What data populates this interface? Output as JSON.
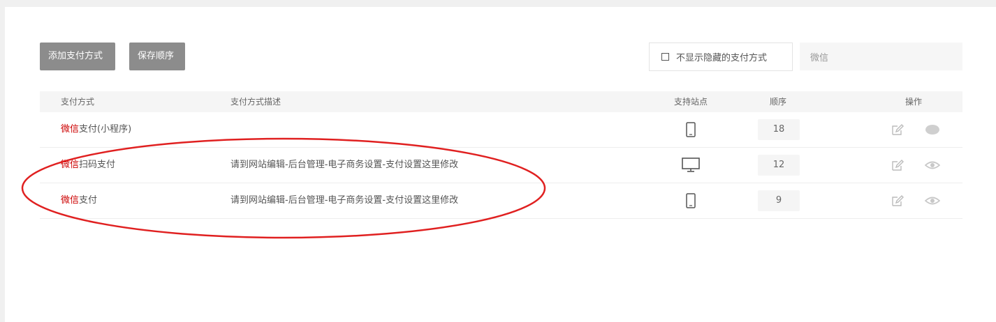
{
  "toolbar": {
    "add_label": "添加支付方式",
    "save_label": "保存顺序",
    "hide_hidden_label": "不显示隐藏的支付方式",
    "search_value": "微信"
  },
  "table": {
    "headers": {
      "method": "支付方式",
      "description": "支付方式描述",
      "site": "支持站点",
      "order": "顺序",
      "actions": "操作"
    },
    "rows": [
      {
        "name_highlight": "微信",
        "name_rest": "支付(小程序)",
        "description": "",
        "site_icon": "mobile-icon",
        "order": "18",
        "visible": false
      },
      {
        "name_highlight": "微信",
        "name_rest": "扫码支付",
        "description": "请到网站编辑-后台管理-电子商务设置-支付设置这里修改",
        "site_icon": "desktop-icon",
        "order": "12",
        "visible": true
      },
      {
        "name_highlight": "微信",
        "name_rest": "支付",
        "description": "请到网站编辑-后台管理-电子商务设置-支付设置这里修改",
        "site_icon": "mobile-icon",
        "order": "9",
        "visible": true
      }
    ]
  },
  "colors": {
    "highlight": "#cc0000",
    "annotation": "#e02020",
    "button": "#8c8c8c"
  }
}
